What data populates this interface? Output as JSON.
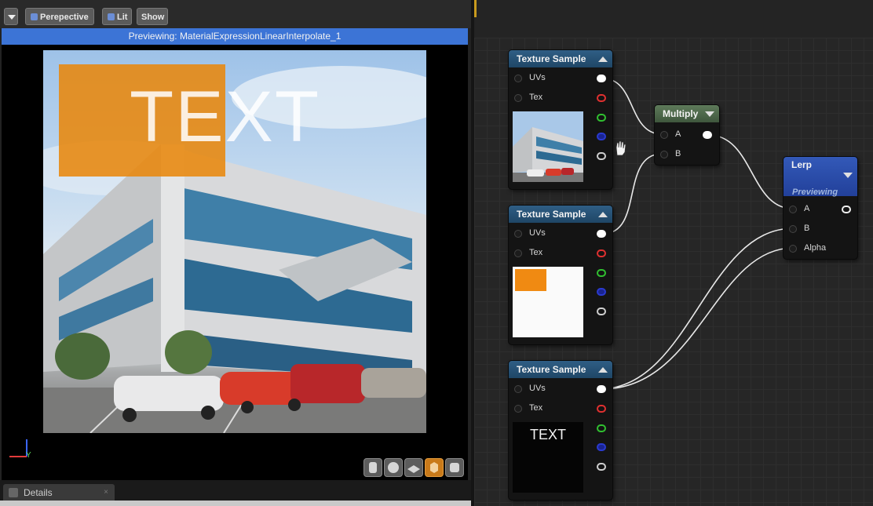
{
  "viewport": {
    "toolbar": {
      "menu_icon": "chevron-down-icon",
      "perspective_label": "Perepective",
      "lit_label": "Lit",
      "show_label": "Show"
    },
    "preview_title": "Previewing: MaterialExpressionLinearInterpolate_1",
    "overlay_text": "TEXT",
    "axis_label": "Y",
    "view_icons": [
      "cylinder-icon",
      "sphere-icon",
      "plane-icon",
      "cube-icon",
      "rounded-cube-icon"
    ]
  },
  "details": {
    "tab_label": "Details",
    "close_glyph": "×"
  },
  "graph": {
    "nodes": [
      {
        "title": "Texture Sample",
        "pins": [
          "UVs",
          "Tex"
        ],
        "outputs": [
          "#ffffff",
          "#e03030",
          "#30c030",
          "#2a3ad0",
          "#ffffff"
        ]
      },
      {
        "title": "Texture Sample",
        "pins": [
          "UVs",
          "Tex"
        ],
        "outputs": [
          "#ffffff",
          "#e03030",
          "#30c030",
          "#2a3ad0",
          "#ffffff"
        ]
      },
      {
        "title": "Texture Sample",
        "pins": [
          "UVs",
          "Tex"
        ],
        "thumb_text": "TEXT",
        "outputs": [
          "#ffffff",
          "#e03030",
          "#30c030",
          "#2a3ad0",
          "#ffffff"
        ]
      }
    ],
    "multiply": {
      "title": "Multiply",
      "pins": [
        "A",
        "B"
      ]
    },
    "lerp": {
      "title": "Lerp",
      "subtitle": "Previewing",
      "pins": [
        "A",
        "B",
        "Alpha"
      ]
    }
  },
  "colors": {
    "preview_bar": "#3c74d6",
    "orange_overlay": "#e8870c",
    "texture_node_header": "#2f5e85",
    "multiply_header": "#5e7a5a",
    "lerp_header": "#3359b8"
  }
}
